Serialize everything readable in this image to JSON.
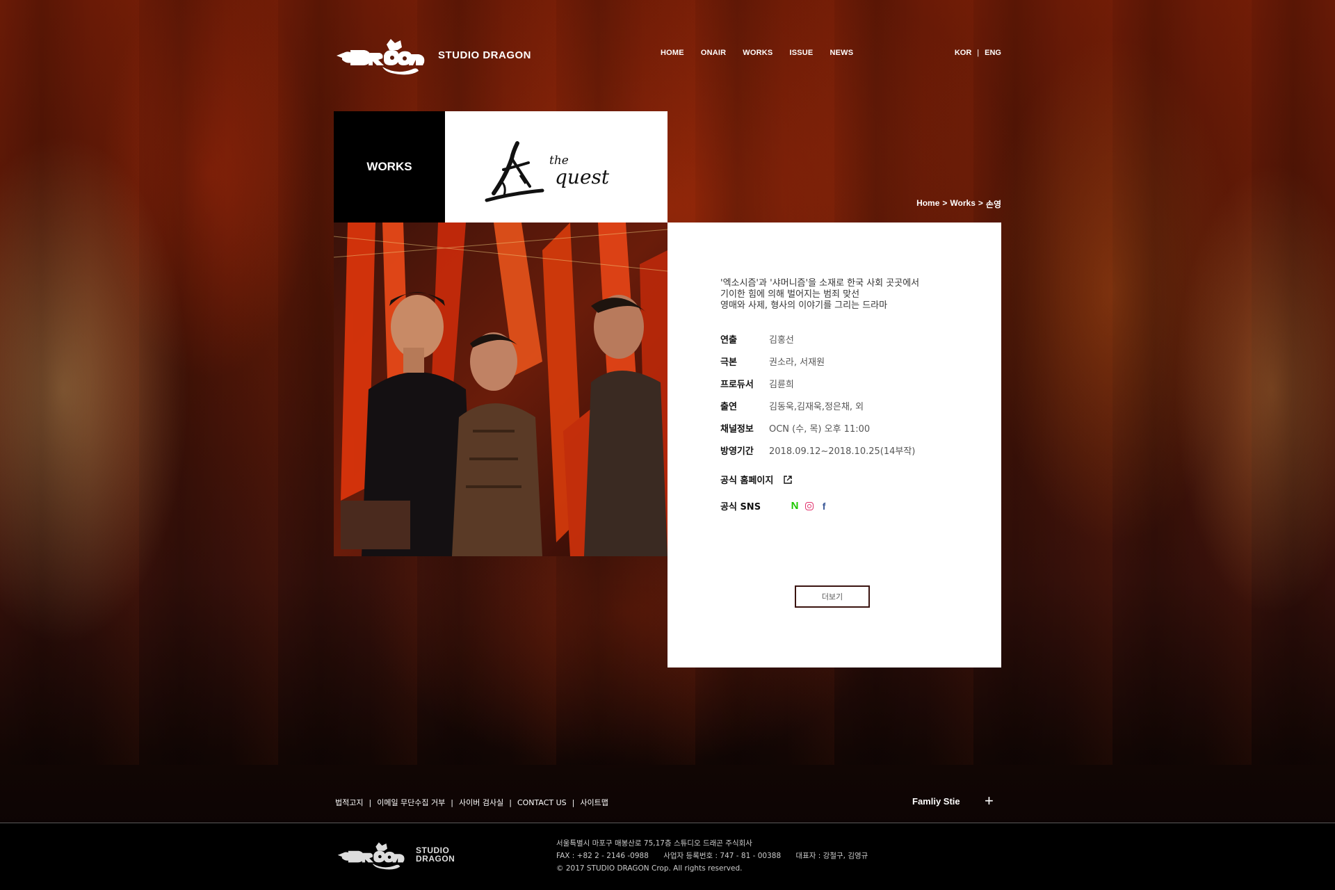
{
  "header": {
    "brand_text": "STUDIO DRAGON",
    "nav": [
      "HOME",
      "ONAIR",
      "WORKS",
      "ISSUE",
      "NEWS"
    ],
    "lang": {
      "kor": "KOR",
      "sep": "|",
      "eng": "ENG"
    }
  },
  "works_label": "WORKS",
  "breadcrumb": {
    "home": "Home",
    "sep1": ">",
    "works": "Works",
    "sep2": ">",
    "current": "손영"
  },
  "info": {
    "synopsis": [
      "'엑소시즘'과 '샤머니즘'을 소재로 한국 사회 곳곳에서",
      "기이한 힘에 의해 벌어지는 범죄 맞선",
      "영매와 사제, 형사의 이야기를 그리는 드라마"
    ],
    "rows": [
      {
        "key": "연출",
        "value": "김홍선"
      },
      {
        "key": "극본",
        "value": "권소라, 서재원"
      },
      {
        "key": "프로듀서",
        "value": "김륜희"
      },
      {
        "key": "출연",
        "value": "김동욱,김재욱,정은채, 외"
      },
      {
        "key": "채널정보",
        "value": "OCN (수, 목) 오후 11:00"
      },
      {
        "key": "방영기간",
        "value": "2018.09.12~2018.10.25(14부작)"
      }
    ],
    "homepage_label": "공식 홈페이지",
    "sns_label": "공식 SNS",
    "sns_icons": [
      "naver-icon",
      "instagram-icon",
      "facebook-icon"
    ],
    "more_label": "더보기"
  },
  "footer": {
    "links": [
      "법적고지",
      "이메일 무단수집 거부",
      "사이버 검사실",
      "CONTACT US",
      "사이트맵"
    ],
    "link_sep": "|",
    "family_label": "Famliy Stie",
    "plus": "+",
    "brand_line1": "STUDIO",
    "brand_line2": "DRAGON",
    "address": "서울특별시 마포구 매봉산로 75,17층 스튜디오 드래곤 주식회사",
    "fax": "FAX : +82 2 - 2146 -0988",
    "biz_no": "사업자 등록번호 : 747 - 81 - 00388",
    "ceo": "대표자 : 강철구, 김영규",
    "copyright": "© 2017 STUDIO DRAGON Crop. All rights reserved."
  },
  "colors": {
    "accent_border": "#3a1410",
    "naver": "#1ec800",
    "instagram": "#e1306c",
    "facebook": "#3b5998"
  }
}
